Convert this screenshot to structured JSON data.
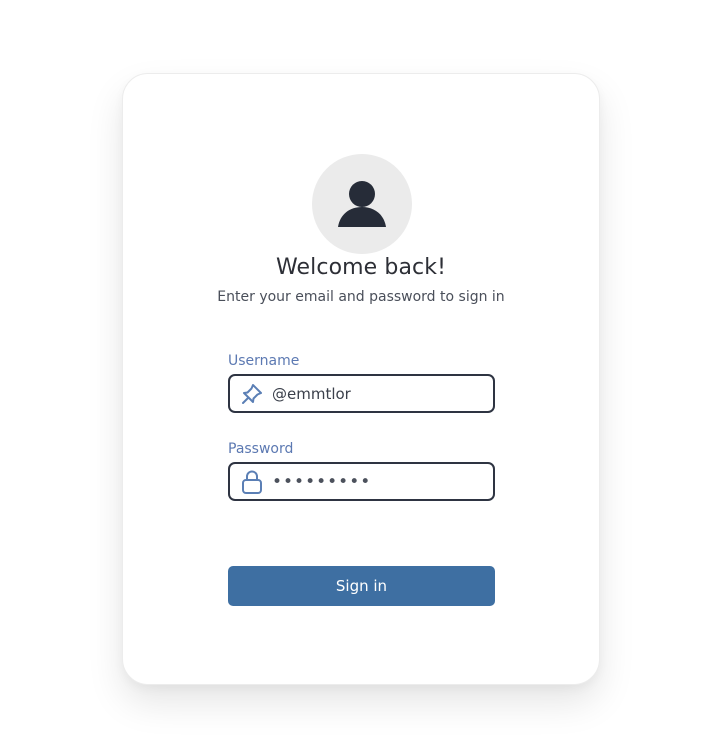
{
  "header": {
    "avatar_icon": "user-silhouette-icon",
    "title": "Welcome back!",
    "subtitle": "Enter your email and password to sign in"
  },
  "form": {
    "username": {
      "label": "Username",
      "icon": "pin-icon",
      "value": "@emmtlor"
    },
    "password": {
      "label": "Password",
      "icon": "lock-icon",
      "value": "•••••••••"
    },
    "submit_label": "Sign in"
  },
  "colors": {
    "accent": "#3e6fa2",
    "label": "#5c79b2",
    "icon": "#5b7fb5",
    "field_border": "#2e3442",
    "avatar_bg": "#ebebeb"
  }
}
